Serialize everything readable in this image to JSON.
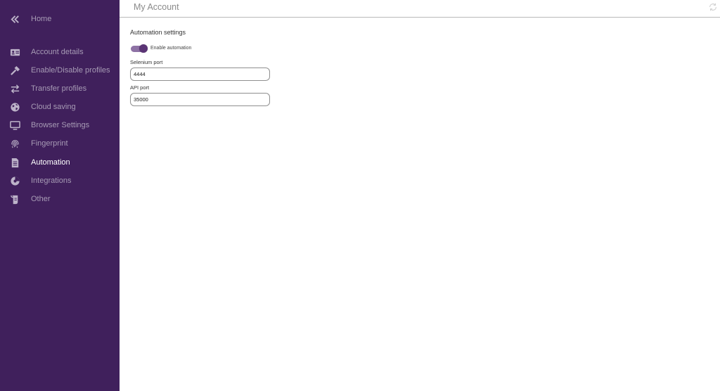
{
  "sidebar": {
    "back_icon": "double-chevron-left-icon",
    "home_label": "Home",
    "items": [
      {
        "id": "account-details",
        "label": "Account details",
        "icon": "id-card-icon"
      },
      {
        "id": "enable-disable-profiles",
        "label": "Enable/Disable profiles",
        "icon": "hammer-icon"
      },
      {
        "id": "transfer-profiles",
        "label": "Transfer profiles",
        "icon": "transfer-arrows-icon"
      },
      {
        "id": "cloud-saving",
        "label": "Cloud saving",
        "icon": "globe-icon"
      },
      {
        "id": "browser-settings",
        "label": "Browser Settings",
        "icon": "monitor-icon"
      },
      {
        "id": "fingerprint",
        "label": "Fingerprint",
        "icon": "fingerprint-icon"
      },
      {
        "id": "automation",
        "label": "Automation",
        "icon": "document-icon",
        "active": true
      },
      {
        "id": "integrations",
        "label": "Integrations",
        "icon": "pie-globe-icon"
      },
      {
        "id": "other",
        "label": "Other",
        "icon": "scroll-icon"
      }
    ]
  },
  "header": {
    "title": "My Account",
    "refresh_icon": "refresh-icon"
  },
  "automation": {
    "section_title": "Automation settings",
    "toggle_label": "Enable automation",
    "toggle_on": true,
    "selenium_label": "Selenium port",
    "selenium_value": "4444",
    "api_label": "API port",
    "api_value": "35000"
  },
  "colors": {
    "sidebar_bg": "#40205c",
    "sidebar_text": "#a79bb5",
    "sidebar_active_text": "#ffffff",
    "toggle_track": "#8e72a5",
    "toggle_knob": "#5b3475"
  }
}
